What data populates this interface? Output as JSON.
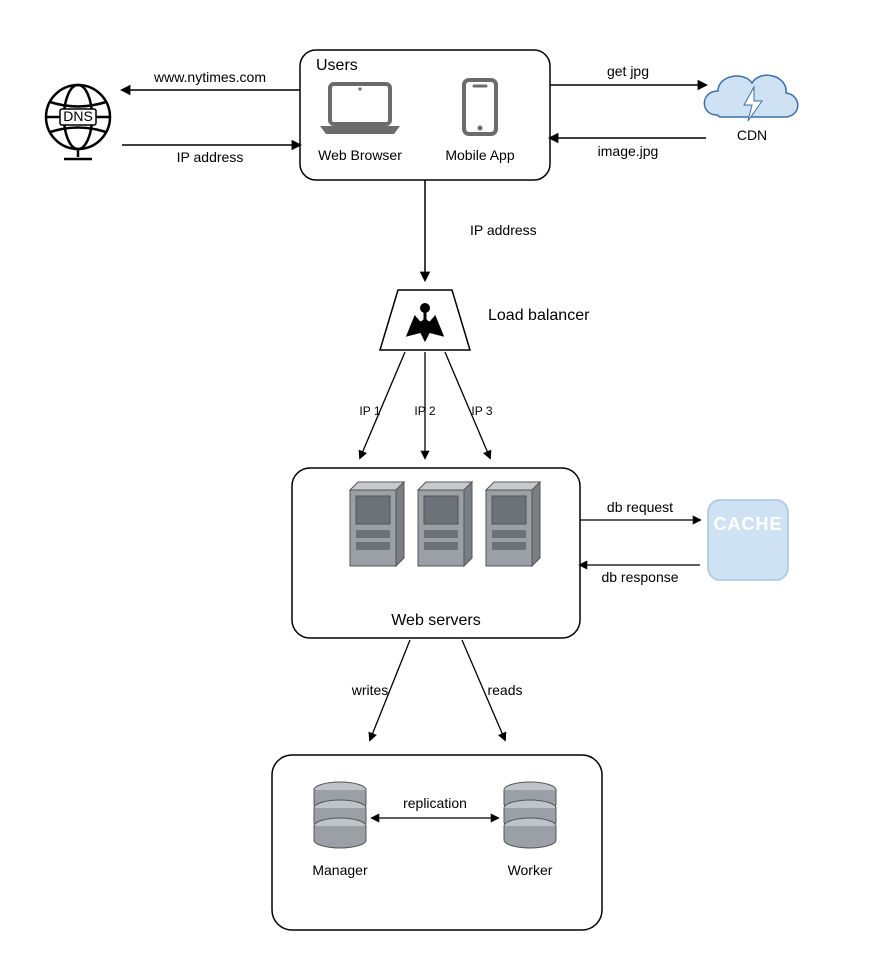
{
  "nodes": {
    "dns": {
      "label": "DNS"
    },
    "users": {
      "title": "Users",
      "web_browser_label": "Web Browser",
      "mobile_app_label": "Mobile App"
    },
    "cdn": {
      "label": "CDN"
    },
    "load_balancer": {
      "label": "Load balancer"
    },
    "web_servers": {
      "label": "Web servers"
    },
    "cache": {
      "label": "CACHE"
    },
    "db": {
      "manager_label": "Manager",
      "worker_label": "Worker",
      "replication_label": "replication"
    }
  },
  "edges": {
    "users_to_dns": "www.nytimes.com",
    "dns_to_users": "IP address",
    "users_to_cdn": "get jpg",
    "cdn_to_users": "image.jpg",
    "users_to_lb": "IP address",
    "lb_to_web_1": "IP 1",
    "lb_to_web_2": "IP 2",
    "lb_to_web_3": "IP 3",
    "web_to_cache_req": "db request",
    "web_to_cache_resp": "db response",
    "web_to_db_writes": "writes",
    "web_to_db_reads": "reads"
  }
}
